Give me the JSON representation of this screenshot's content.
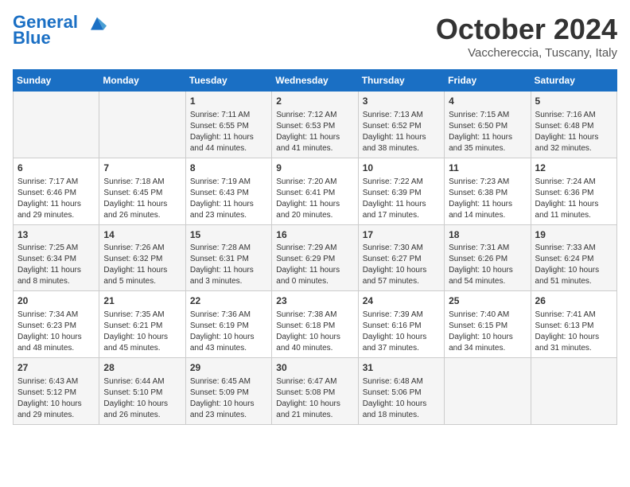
{
  "header": {
    "logo_line1": "General",
    "logo_line2": "Blue",
    "month": "October 2024",
    "location": "Vacchereccia, Tuscany, Italy"
  },
  "days_of_week": [
    "Sunday",
    "Monday",
    "Tuesday",
    "Wednesday",
    "Thursday",
    "Friday",
    "Saturday"
  ],
  "weeks": [
    [
      {
        "day": "",
        "info": ""
      },
      {
        "day": "",
        "info": ""
      },
      {
        "day": "1",
        "info": "Sunrise: 7:11 AM\nSunset: 6:55 PM\nDaylight: 11 hours and 44 minutes."
      },
      {
        "day": "2",
        "info": "Sunrise: 7:12 AM\nSunset: 6:53 PM\nDaylight: 11 hours and 41 minutes."
      },
      {
        "day": "3",
        "info": "Sunrise: 7:13 AM\nSunset: 6:52 PM\nDaylight: 11 hours and 38 minutes."
      },
      {
        "day": "4",
        "info": "Sunrise: 7:15 AM\nSunset: 6:50 PM\nDaylight: 11 hours and 35 minutes."
      },
      {
        "day": "5",
        "info": "Sunrise: 7:16 AM\nSunset: 6:48 PM\nDaylight: 11 hours and 32 minutes."
      }
    ],
    [
      {
        "day": "6",
        "info": "Sunrise: 7:17 AM\nSunset: 6:46 PM\nDaylight: 11 hours and 29 minutes."
      },
      {
        "day": "7",
        "info": "Sunrise: 7:18 AM\nSunset: 6:45 PM\nDaylight: 11 hours and 26 minutes."
      },
      {
        "day": "8",
        "info": "Sunrise: 7:19 AM\nSunset: 6:43 PM\nDaylight: 11 hours and 23 minutes."
      },
      {
        "day": "9",
        "info": "Sunrise: 7:20 AM\nSunset: 6:41 PM\nDaylight: 11 hours and 20 minutes."
      },
      {
        "day": "10",
        "info": "Sunrise: 7:22 AM\nSunset: 6:39 PM\nDaylight: 11 hours and 17 minutes."
      },
      {
        "day": "11",
        "info": "Sunrise: 7:23 AM\nSunset: 6:38 PM\nDaylight: 11 hours and 14 minutes."
      },
      {
        "day": "12",
        "info": "Sunrise: 7:24 AM\nSunset: 6:36 PM\nDaylight: 11 hours and 11 minutes."
      }
    ],
    [
      {
        "day": "13",
        "info": "Sunrise: 7:25 AM\nSunset: 6:34 PM\nDaylight: 11 hours and 8 minutes."
      },
      {
        "day": "14",
        "info": "Sunrise: 7:26 AM\nSunset: 6:32 PM\nDaylight: 11 hours and 5 minutes."
      },
      {
        "day": "15",
        "info": "Sunrise: 7:28 AM\nSunset: 6:31 PM\nDaylight: 11 hours and 3 minutes."
      },
      {
        "day": "16",
        "info": "Sunrise: 7:29 AM\nSunset: 6:29 PM\nDaylight: 11 hours and 0 minutes."
      },
      {
        "day": "17",
        "info": "Sunrise: 7:30 AM\nSunset: 6:27 PM\nDaylight: 10 hours and 57 minutes."
      },
      {
        "day": "18",
        "info": "Sunrise: 7:31 AM\nSunset: 6:26 PM\nDaylight: 10 hours and 54 minutes."
      },
      {
        "day": "19",
        "info": "Sunrise: 7:33 AM\nSunset: 6:24 PM\nDaylight: 10 hours and 51 minutes."
      }
    ],
    [
      {
        "day": "20",
        "info": "Sunrise: 7:34 AM\nSunset: 6:23 PM\nDaylight: 10 hours and 48 minutes."
      },
      {
        "day": "21",
        "info": "Sunrise: 7:35 AM\nSunset: 6:21 PM\nDaylight: 10 hours and 45 minutes."
      },
      {
        "day": "22",
        "info": "Sunrise: 7:36 AM\nSunset: 6:19 PM\nDaylight: 10 hours and 43 minutes."
      },
      {
        "day": "23",
        "info": "Sunrise: 7:38 AM\nSunset: 6:18 PM\nDaylight: 10 hours and 40 minutes."
      },
      {
        "day": "24",
        "info": "Sunrise: 7:39 AM\nSunset: 6:16 PM\nDaylight: 10 hours and 37 minutes."
      },
      {
        "day": "25",
        "info": "Sunrise: 7:40 AM\nSunset: 6:15 PM\nDaylight: 10 hours and 34 minutes."
      },
      {
        "day": "26",
        "info": "Sunrise: 7:41 AM\nSunset: 6:13 PM\nDaylight: 10 hours and 31 minutes."
      }
    ],
    [
      {
        "day": "27",
        "info": "Sunrise: 6:43 AM\nSunset: 5:12 PM\nDaylight: 10 hours and 29 minutes."
      },
      {
        "day": "28",
        "info": "Sunrise: 6:44 AM\nSunset: 5:10 PM\nDaylight: 10 hours and 26 minutes."
      },
      {
        "day": "29",
        "info": "Sunrise: 6:45 AM\nSunset: 5:09 PM\nDaylight: 10 hours and 23 minutes."
      },
      {
        "day": "30",
        "info": "Sunrise: 6:47 AM\nSunset: 5:08 PM\nDaylight: 10 hours and 21 minutes."
      },
      {
        "day": "31",
        "info": "Sunrise: 6:48 AM\nSunset: 5:06 PM\nDaylight: 10 hours and 18 minutes."
      },
      {
        "day": "",
        "info": ""
      },
      {
        "day": "",
        "info": ""
      }
    ]
  ]
}
